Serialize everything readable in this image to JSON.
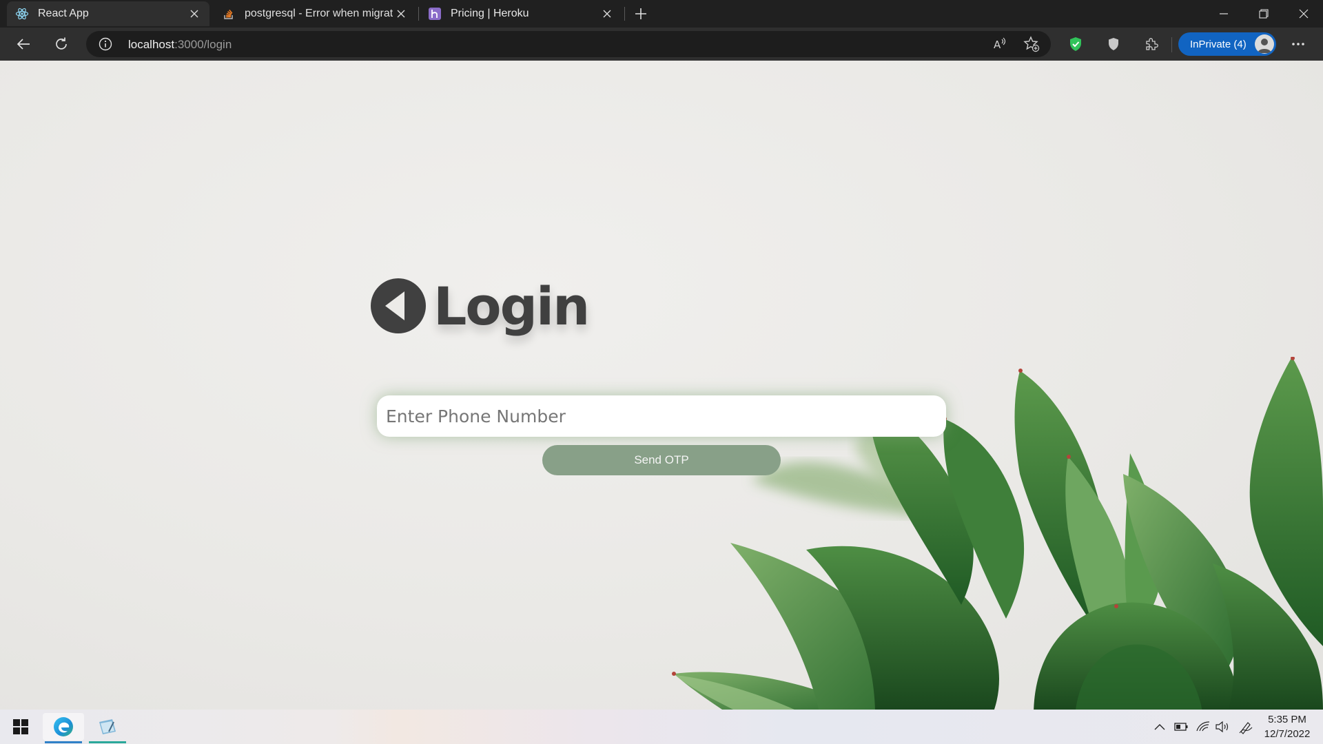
{
  "browser": {
    "tabs": [
      {
        "title": "React App",
        "favicon": "react-icon",
        "active": true
      },
      {
        "title": "postgresql - Error when migrating",
        "favicon": "stackoverflow-icon",
        "active": false
      },
      {
        "title": "Pricing | Heroku",
        "favicon": "heroku-icon",
        "active": false
      }
    ],
    "address": {
      "host": "localhost",
      "path": ":3000/login"
    },
    "profile_label": "InPrivate (4)"
  },
  "page": {
    "title": "Login",
    "phone_placeholder": "Enter Phone Number",
    "phone_value": "",
    "send_otp_label": "Send OTP"
  },
  "taskbar": {
    "time": "5:35 PM",
    "date": "12/7/2022"
  },
  "colors": {
    "accent_button": "#88a088",
    "input_glow": "#78a06e",
    "title_text": "#404040",
    "inprivate_badge": "#1164c2"
  }
}
